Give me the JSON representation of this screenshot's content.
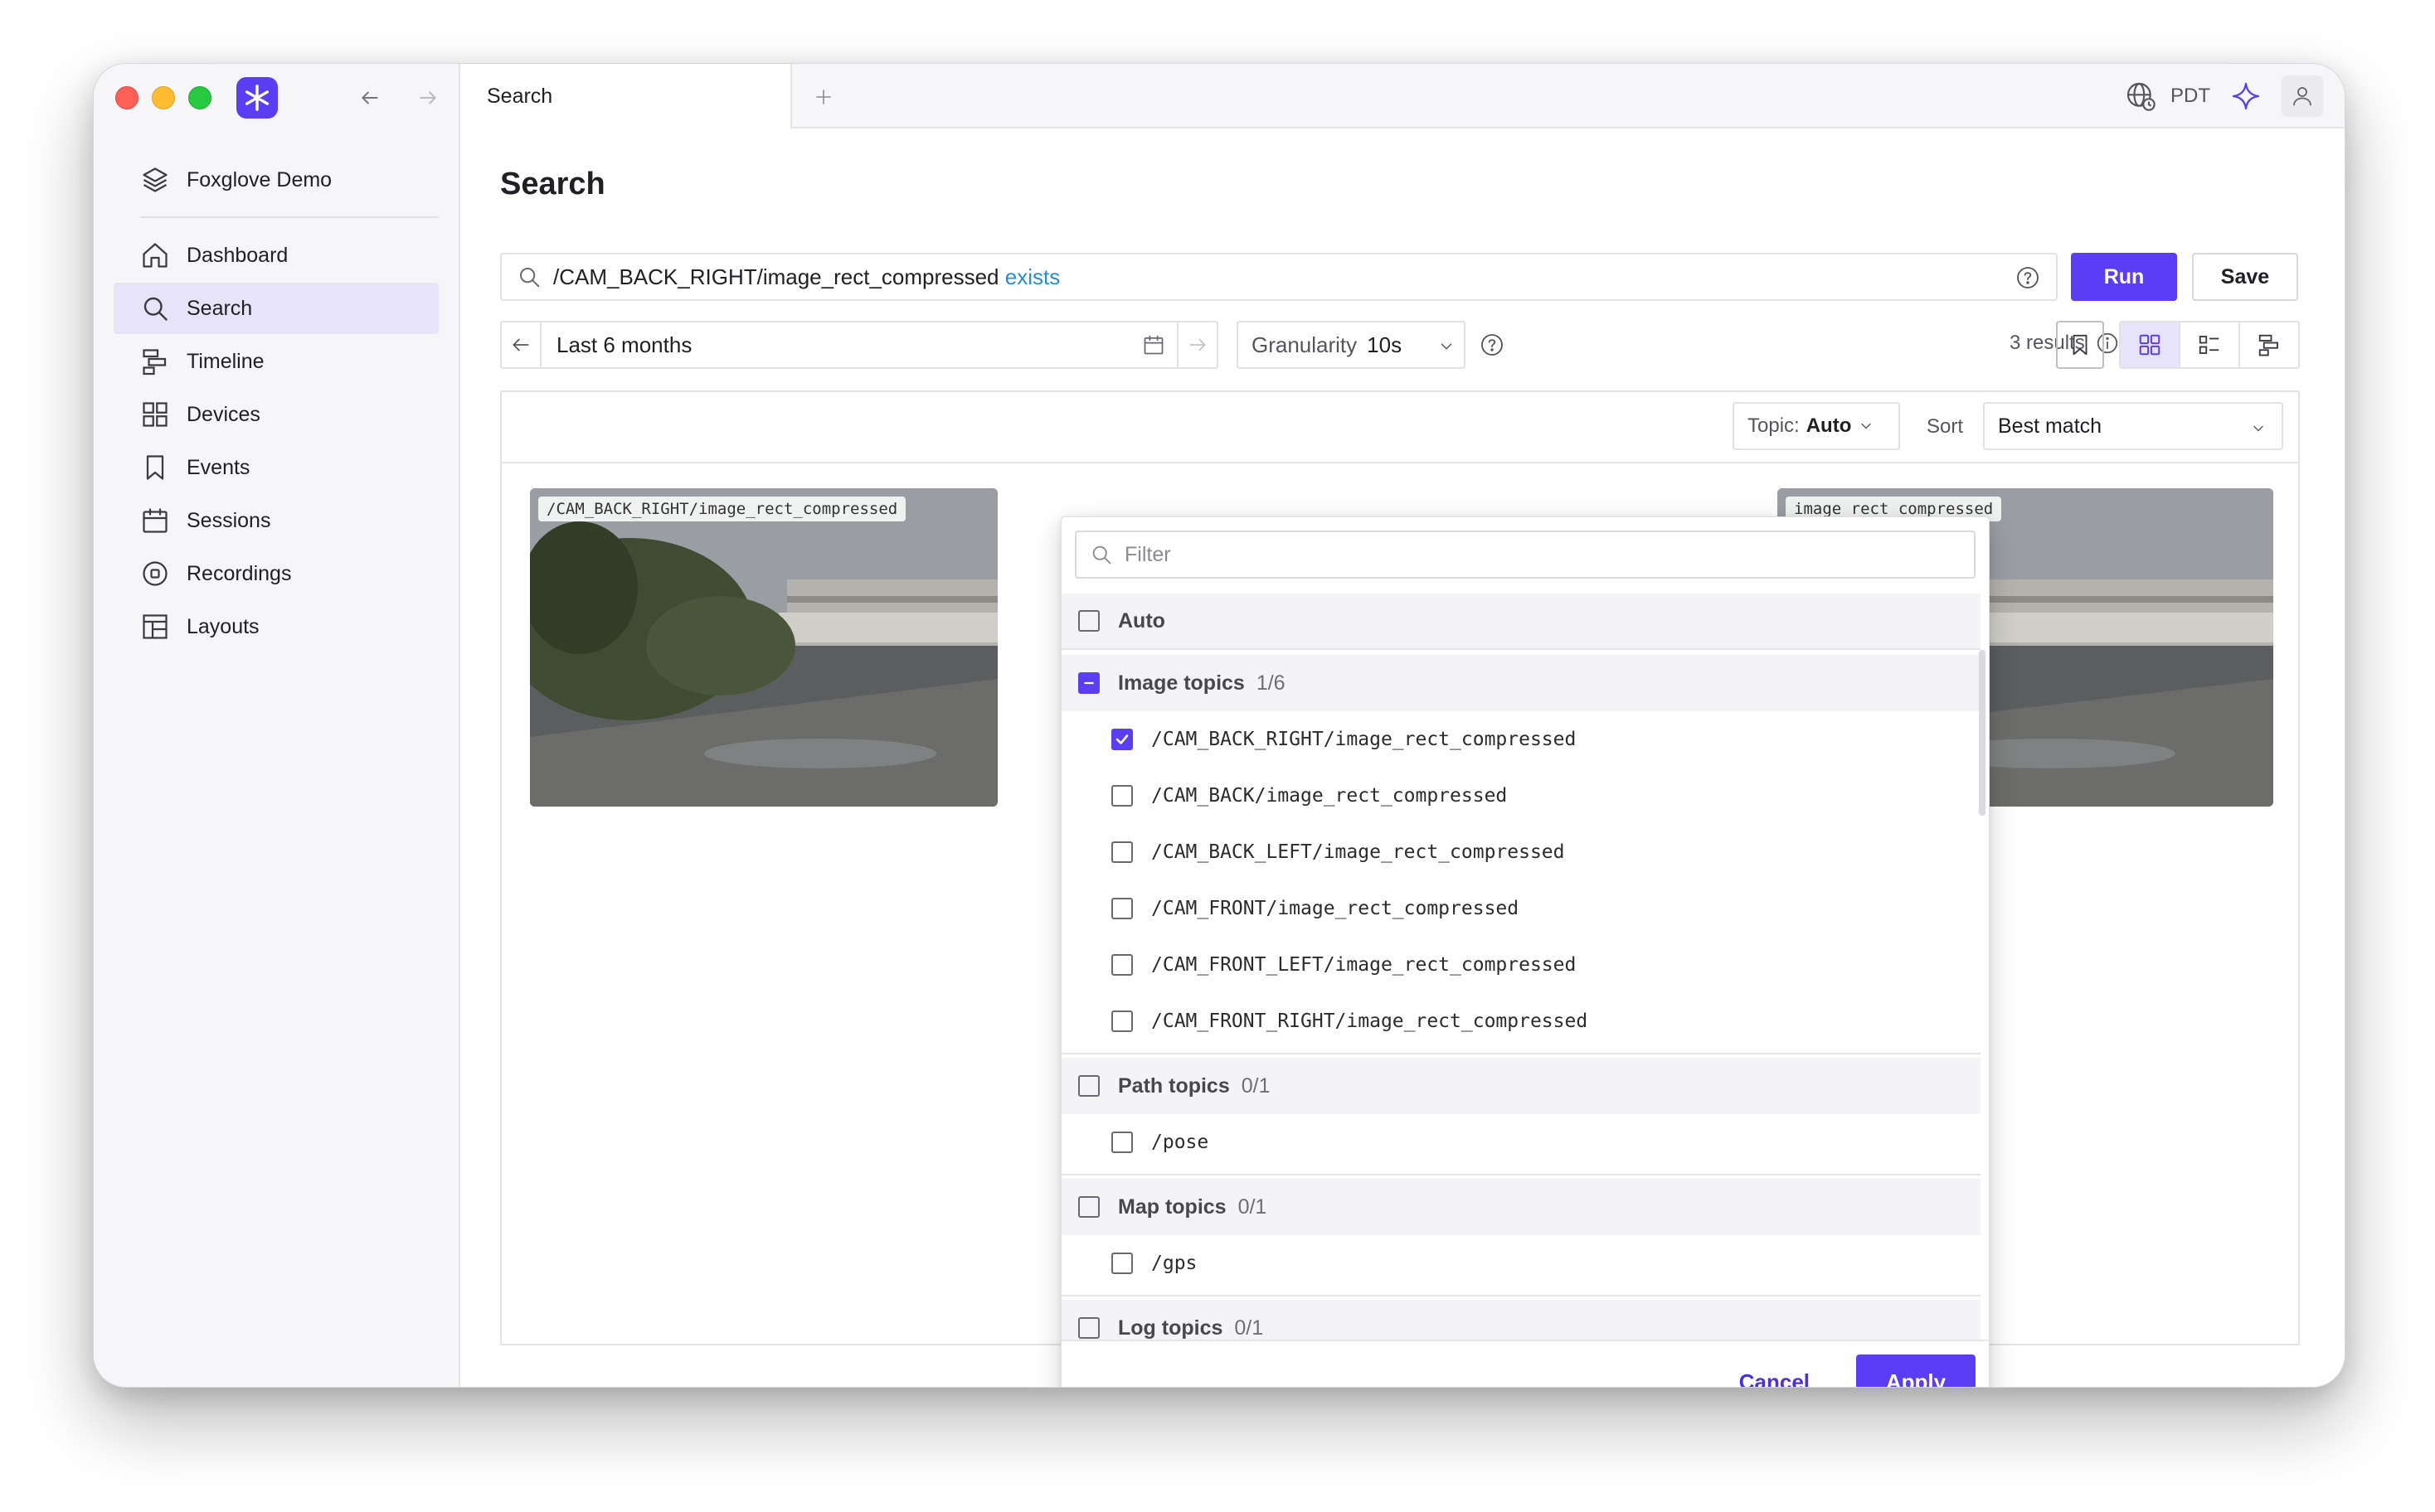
{
  "sidebar": {
    "workspace": "Foxglove Demo",
    "items": [
      {
        "label": "Dashboard",
        "icon": "home-icon"
      },
      {
        "label": "Search",
        "icon": "search-icon"
      },
      {
        "label": "Timeline",
        "icon": "timeline-icon"
      },
      {
        "label": "Devices",
        "icon": "grid-icon"
      },
      {
        "label": "Events",
        "icon": "bookmark-icon"
      },
      {
        "label": "Sessions",
        "icon": "calendar-icon"
      },
      {
        "label": "Recordings",
        "icon": "record-icon"
      },
      {
        "label": "Layouts",
        "icon": "layout-icon"
      }
    ],
    "active": "Search"
  },
  "tabbar": {
    "tab_title": "Search",
    "timezone": "PDT"
  },
  "main": {
    "page_title": "Search",
    "query_text": "/CAM_BACK_RIGHT/image_rect_compressed",
    "query_keyword": "exists",
    "run_label": "Run",
    "save_label": "Save",
    "date_range": "Last 6 months",
    "granularity_label": "Granularity",
    "granularity_value": "10s",
    "results_count": "3 results",
    "topic_label": "Topic:",
    "topic_value": "Auto",
    "sort_label": "Sort",
    "sort_value": "Best match",
    "cards": [
      {
        "topic": "/CAM_BACK_RIGHT/image_rect_compressed"
      },
      {
        "topic": "image_rect_compressed"
      }
    ]
  },
  "dropdown": {
    "filter_placeholder": "Filter",
    "auto_label": "Auto",
    "groups": [
      {
        "label": "Image topics",
        "count": "1/6",
        "state": "mixed",
        "items": [
          {
            "label": "/CAM_BACK_RIGHT/image_rect_compressed",
            "checked": true
          },
          {
            "label": "/CAM_BACK/image_rect_compressed",
            "checked": false
          },
          {
            "label": "/CAM_BACK_LEFT/image_rect_compressed",
            "checked": false
          },
          {
            "label": "/CAM_FRONT/image_rect_compressed",
            "checked": false
          },
          {
            "label": "/CAM_FRONT_LEFT/image_rect_compressed",
            "checked": false
          },
          {
            "label": "/CAM_FRONT_RIGHT/image_rect_compressed",
            "checked": false
          }
        ]
      },
      {
        "label": "Path topics",
        "count": "0/1",
        "state": "none",
        "items": [
          {
            "label": "/pose",
            "checked": false
          }
        ]
      },
      {
        "label": "Map topics",
        "count": "0/1",
        "state": "none",
        "items": [
          {
            "label": "/gps",
            "checked": false
          }
        ]
      },
      {
        "label": "Log topics",
        "count": "0/1",
        "state": "none",
        "items": []
      }
    ],
    "cancel_label": "Cancel",
    "apply_label": "Apply"
  },
  "colors": {
    "accent": "#5b3df5",
    "keyword": "#2a8bd8",
    "active_nav": "#e6e4f6"
  }
}
